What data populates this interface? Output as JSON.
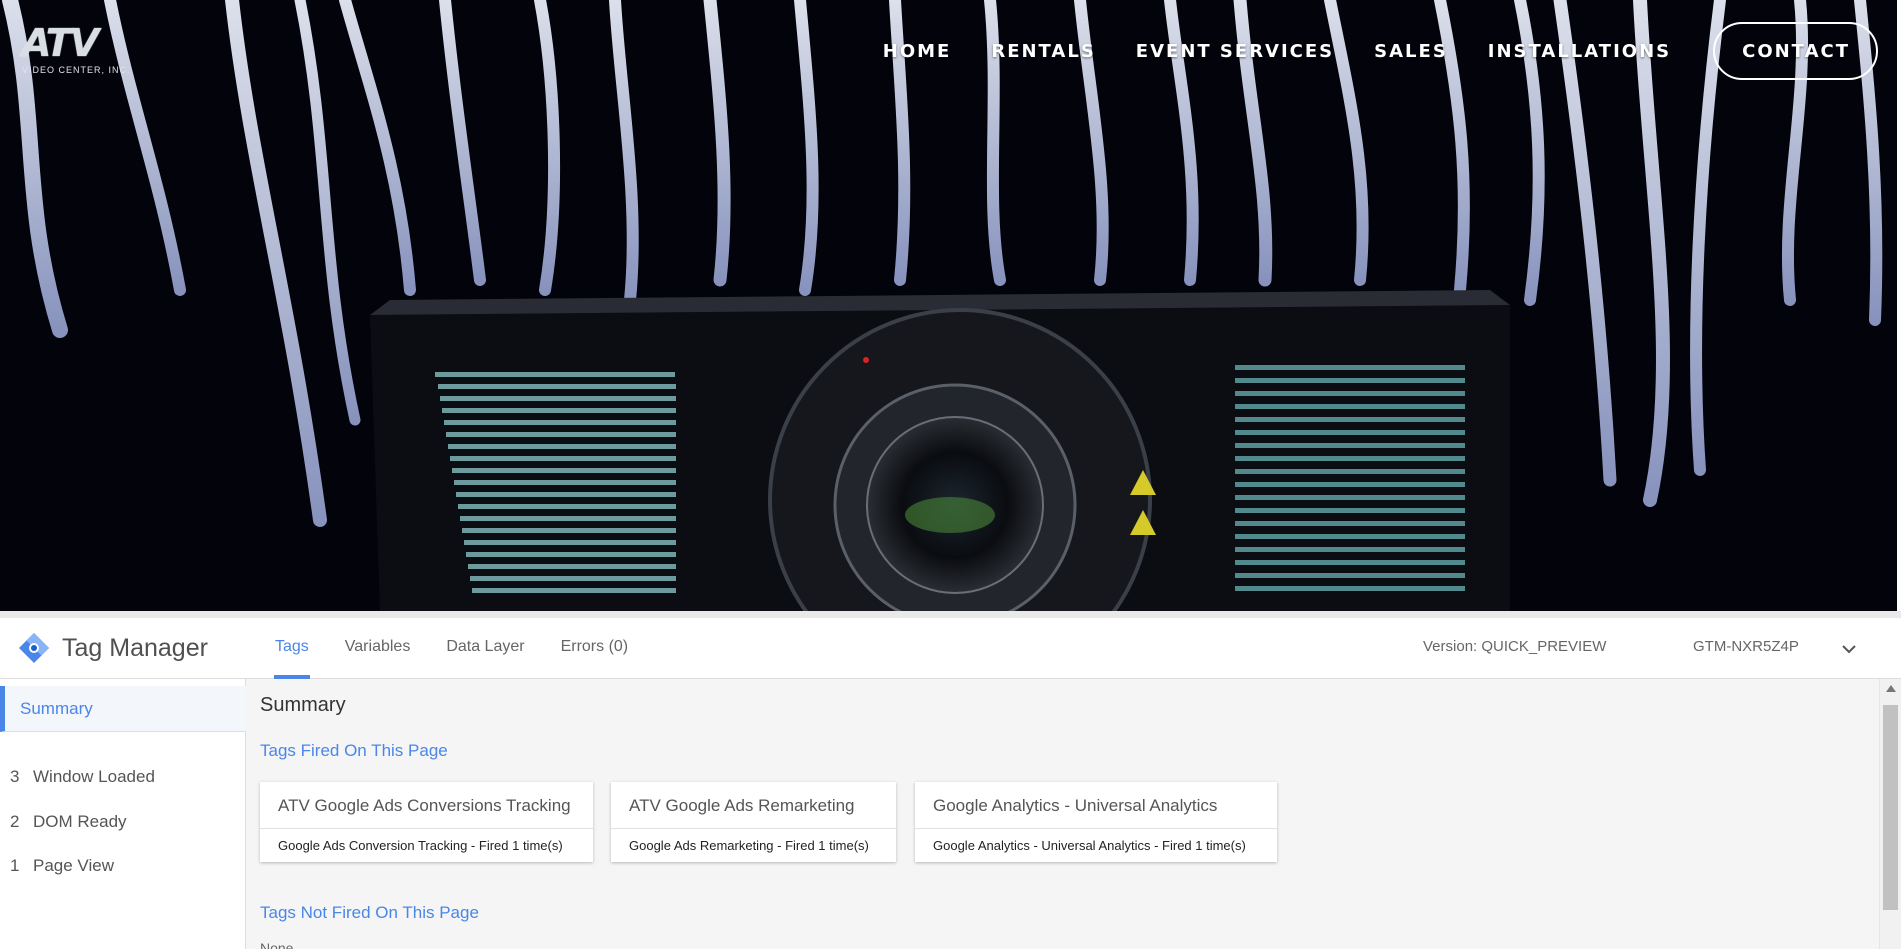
{
  "site": {
    "logo_mark": "ATV",
    "logo_sub": "VIDEO CENTER, INC.",
    "nav": [
      "HOME",
      "RENTALS",
      "EVENT SERVICES",
      "SALES",
      "INSTALLATIONS"
    ],
    "contact_label": "CONTACT"
  },
  "tag_manager": {
    "title": "Tag Manager",
    "tabs": [
      "Tags",
      "Variables",
      "Data Layer",
      "Errors (0)"
    ],
    "active_tab": "Tags",
    "version": "Version: QUICK_PREVIEW",
    "container_id": "GTM-NXR5Z4P",
    "sidebar": {
      "summary_label": "Summary",
      "events": [
        {
          "num": "3",
          "label": "Window Loaded"
        },
        {
          "num": "2",
          "label": "DOM Ready"
        },
        {
          "num": "1",
          "label": "Page View"
        }
      ]
    },
    "main": {
      "heading": "Summary",
      "fired_title": "Tags Fired On This Page",
      "fired_tags": [
        {
          "name": "ATV Google Ads Conversions Tracking",
          "status": "Google Ads Conversion Tracking - Fired 1 time(s)"
        },
        {
          "name": "ATV Google Ads Remarketing",
          "status": "Google Ads Remarketing - Fired 1 time(s)"
        },
        {
          "name": "Google Analytics - Universal Analytics",
          "status": "Google Analytics - Universal Analytics - Fired 1 time(s)"
        }
      ],
      "not_fired_title": "Tags Not Fired On This Page",
      "not_fired_value": "None"
    }
  },
  "colors": {
    "accent": "#4a86e8",
    "hero_bg": "#03030c"
  },
  "icons": {
    "brand": "tag-manager-diamond-icon",
    "dropdown": "chevron-down-icon",
    "scroll_up": "scroll-up-arrow-icon"
  }
}
